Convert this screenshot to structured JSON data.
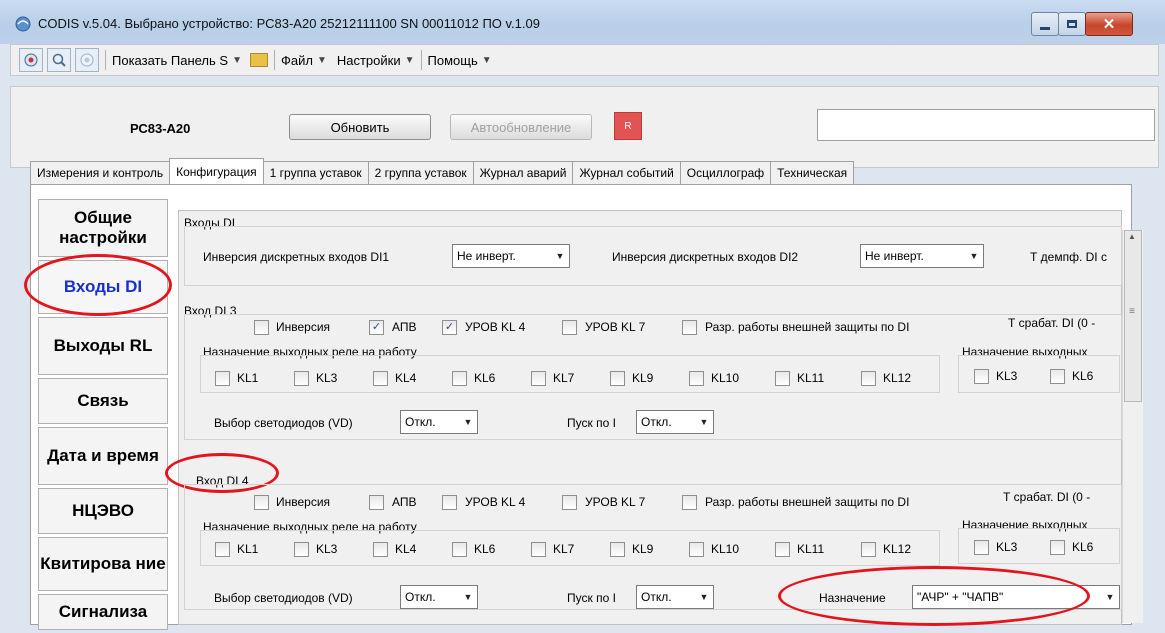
{
  "window": {
    "title": "CODIS v.5.04.  Выбрано устройство: РС83-А20  25212111100  SN 00011012  ПО v.1.09"
  },
  "toolbar": {
    "show_panel": "Показать Панель S",
    "file": "Файл",
    "settings": "Настройки",
    "help": "Помощь"
  },
  "device": {
    "name": "РС83-А20",
    "refresh_button": "Обновить",
    "autorefresh_button": "Автообновление",
    "record_button": "R"
  },
  "tabs": [
    "Измерения и контроль",
    "Конфигурация",
    "1 группа уставок",
    "2 группа уставок",
    "Журнал аварий",
    "Журнал событий",
    "Осциллограф",
    "Техническая"
  ],
  "nav": [
    {
      "label": "Общие настройки"
    },
    {
      "label": "Входы DI"
    },
    {
      "label": "Выходы RL"
    },
    {
      "label": "Связь"
    },
    {
      "label": "Дата и время"
    },
    {
      "label": "НЦЭВО"
    },
    {
      "label": "Квитирова ние"
    },
    {
      "label": "Сигнализа"
    }
  ],
  "di_section": {
    "title": "Входы DI",
    "inversion_di1_label": "Инверсия дискретных входов DI1",
    "inversion_di1_value": "Не инверт.",
    "inversion_di2_label": "Инверсия дискретных входов DI2",
    "inversion_di2_value": "Не инверт.",
    "t_damp_label": "Т демпф. DI с"
  },
  "di3": {
    "title": "Вход DI 3",
    "cb_inversion": {
      "label": "Инверсия",
      "checked": false
    },
    "cb_apv": {
      "label": "АПВ",
      "checked": true
    },
    "cb_urov4": {
      "label": "УРОВ KL 4",
      "checked": true
    },
    "cb_urov7": {
      "label": "УРОВ KL 7",
      "checked": false
    },
    "cb_ext": {
      "label": "Разр. работы внешней защиты по DI",
      "checked": false
    },
    "t_trip_label": "Т срабат. DI (0 -",
    "relay_group": "Назначение выходных реле на работу",
    "relays": [
      "KL1",
      "KL3",
      "KL4",
      "KL6",
      "KL7",
      "KL9",
      "KL10",
      "KL11",
      "KL12"
    ],
    "relay_group2": "Назначение выходных",
    "relays2": [
      "KL3",
      "KL6"
    ],
    "vd_label": "Выбор светодиодов (VD)",
    "vd_value": "Откл.",
    "start_label": "Пуск по I",
    "start_value": "Откл."
  },
  "di4": {
    "title": "Вход DI 4",
    "cb_inversion": {
      "label": "Инверсия",
      "checked": false
    },
    "cb_apv": {
      "label": "АПВ",
      "checked": false
    },
    "cb_urov4": {
      "label": "УРОВ KL 4",
      "checked": false
    },
    "cb_urov7": {
      "label": "УРОВ KL 7",
      "checked": false
    },
    "cb_ext": {
      "label": "Разр. работы внешней защиты по DI",
      "checked": false
    },
    "t_trip_label": "Т срабат. DI (0 -",
    "relay_group": "Назначение выходных реле на работу",
    "relays": [
      "KL1",
      "KL3",
      "KL4",
      "KL6",
      "KL7",
      "KL9",
      "KL10",
      "KL11",
      "KL12"
    ],
    "relay_group2": "Назначение выходных",
    "relays2": [
      "KL3",
      "KL6"
    ],
    "vd_label": "Выбор светодиодов (VD)",
    "vd_value": "Откл.",
    "start_label": "Пуск по I",
    "start_value": "Откл.",
    "assign_label": "Назначение",
    "assign_value": "\"АЧР\" + \"ЧАПВ\""
  },
  "colors": {
    "nav_active": "#1a2fd0",
    "highlight": "#e5141c"
  }
}
